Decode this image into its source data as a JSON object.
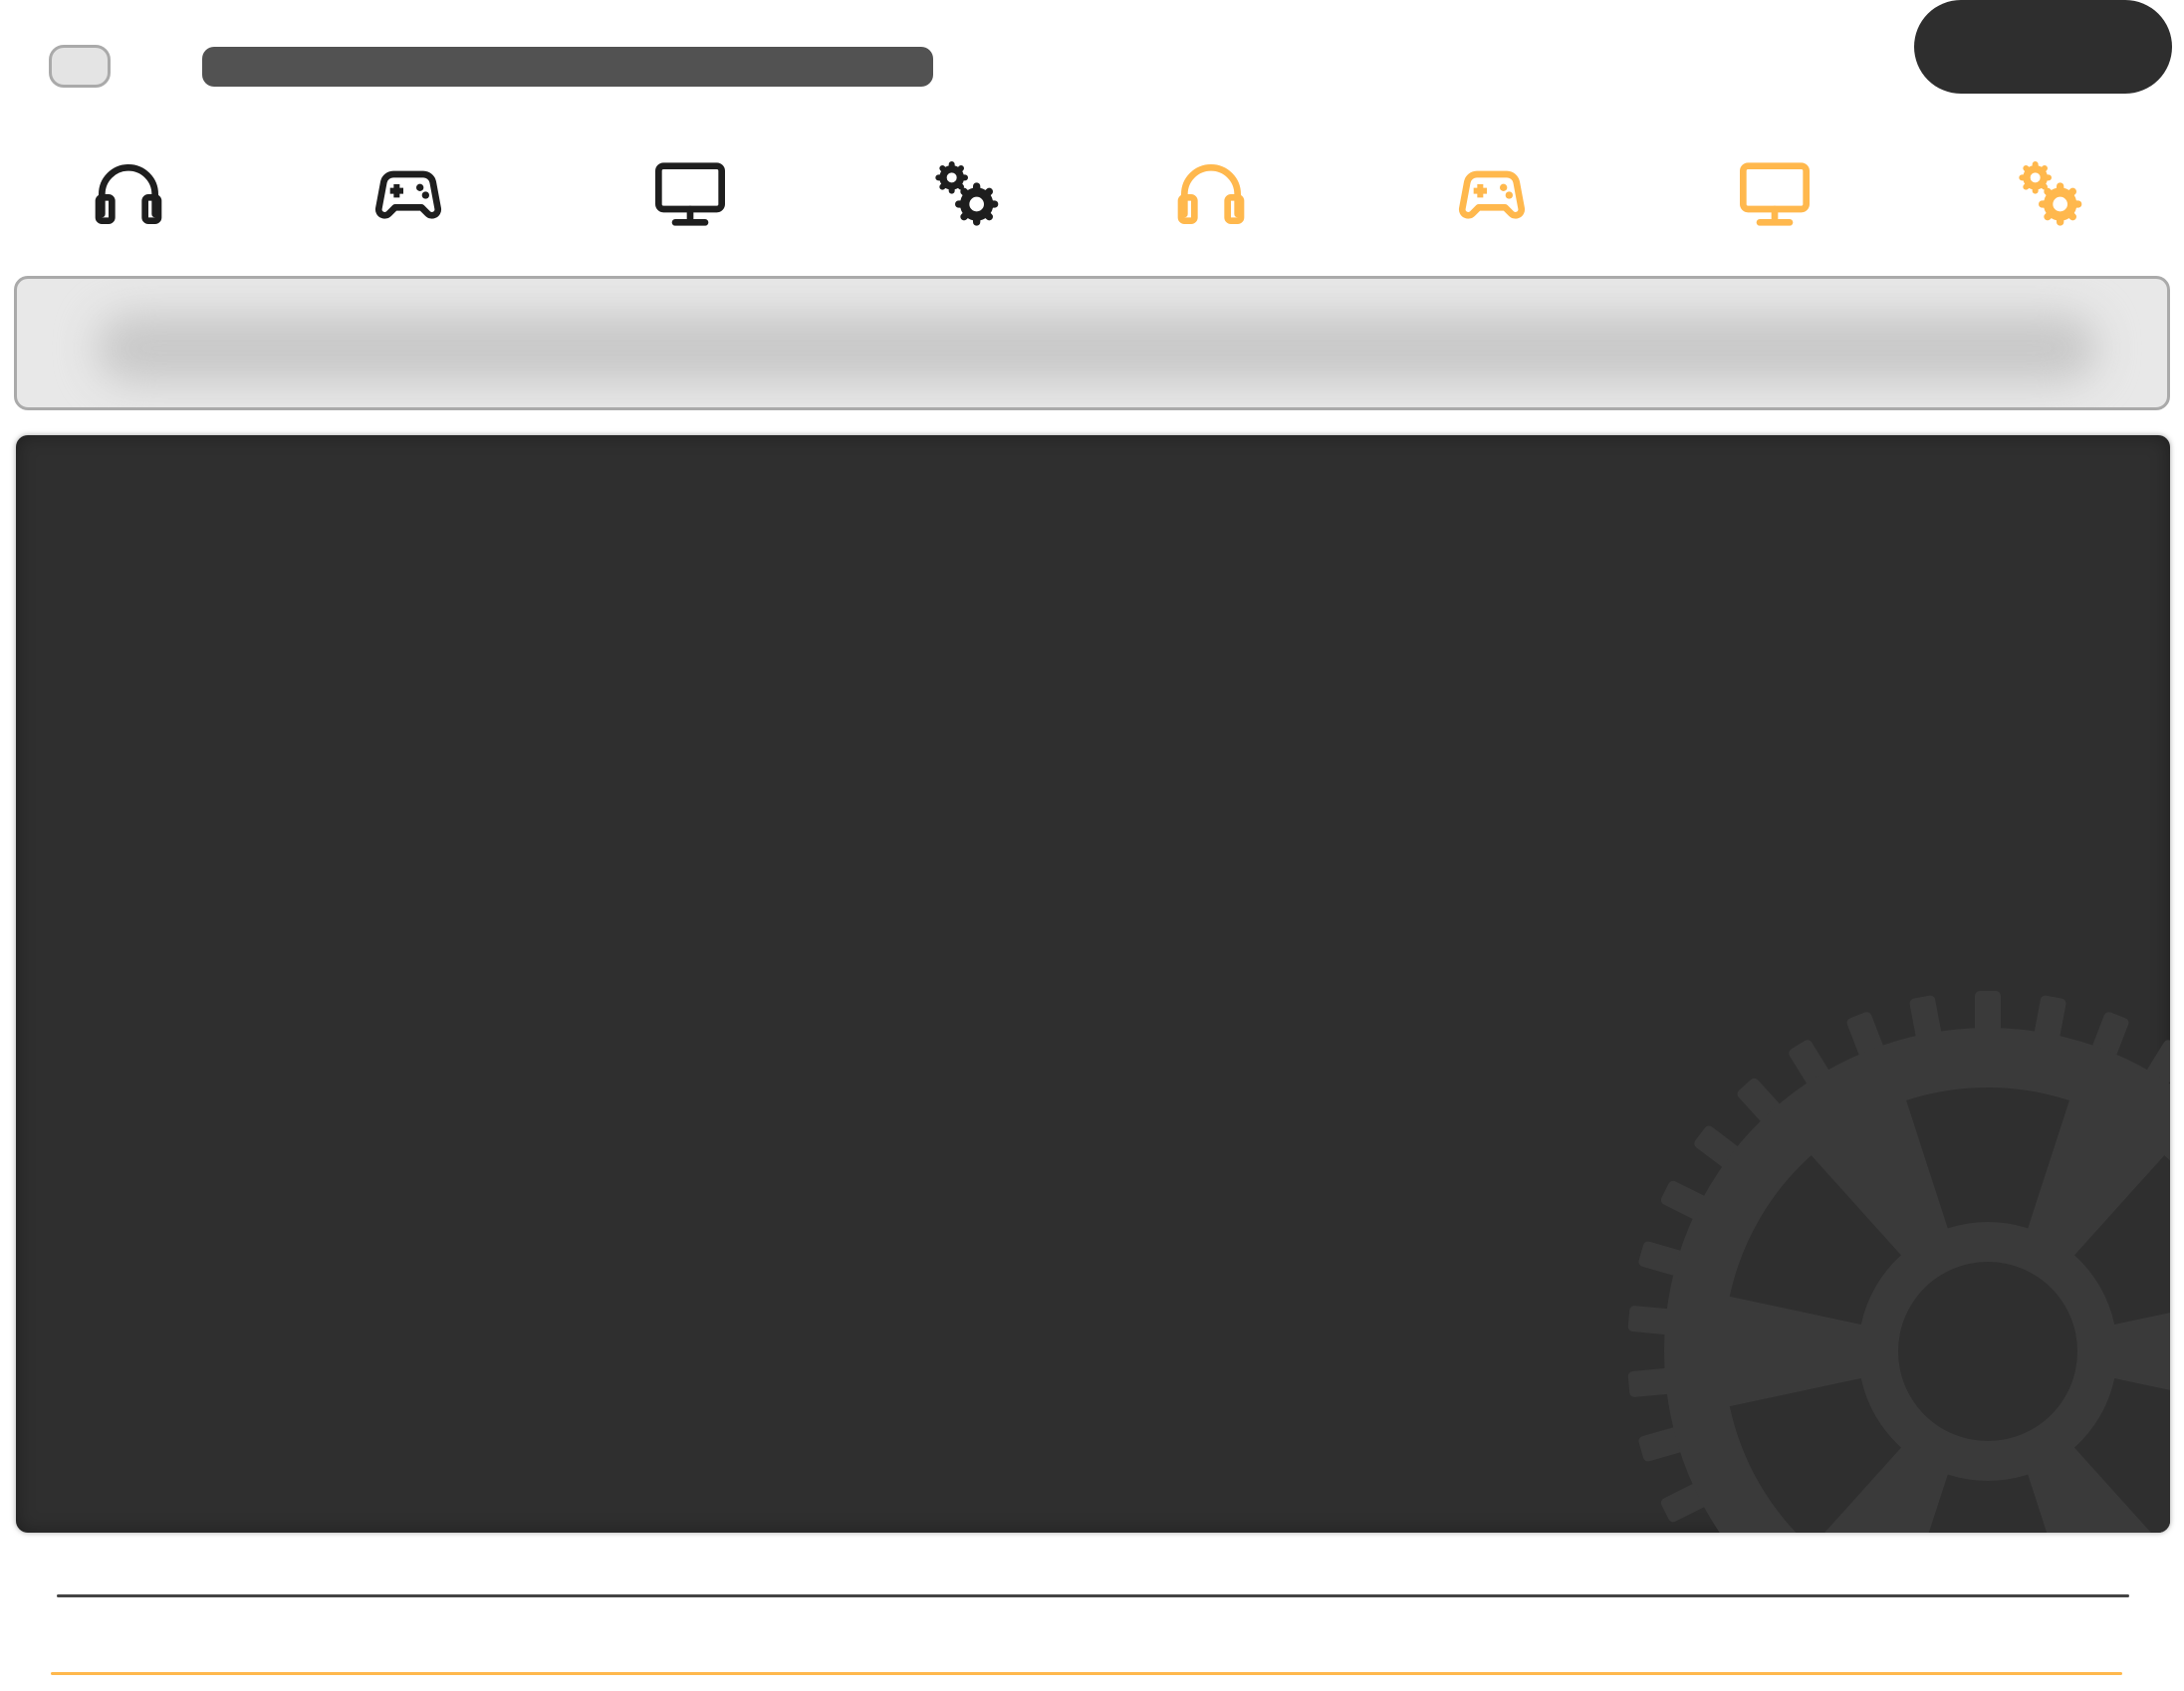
{
  "colors": {
    "icon_dark": "#1e1e1e",
    "icon_accent": "#ffb84d",
    "panel_bg": "#2f2f2f",
    "panel_gear": "#3a3a3a",
    "title_bar": "#525252",
    "top_action": "#2e2e2e"
  },
  "icons": {
    "dark": [
      "headphones-icon",
      "gamepad-icon",
      "monitor-icon",
      "gears-icon"
    ],
    "accent": [
      "headphones-icon",
      "gamepad-icon",
      "monitor-icon",
      "gears-icon"
    ]
  },
  "main_panel": {
    "background_icon": "gear-icon"
  }
}
